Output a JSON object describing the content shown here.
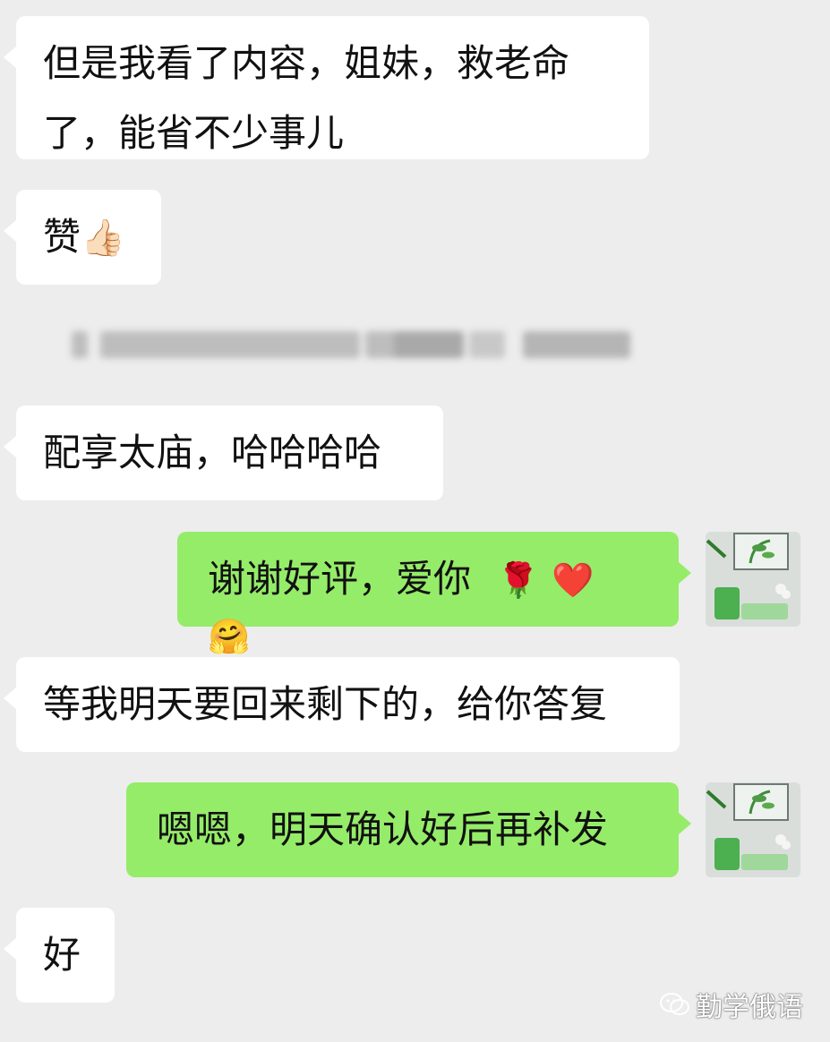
{
  "messages": [
    {
      "side": "left",
      "text_lines": [
        "但是我看了内容，姐妹，救老命",
        "了，能省不少事儿"
      ]
    },
    {
      "side": "left",
      "text": "赞",
      "emoji": "👍🏻"
    },
    {
      "side": "system",
      "text": "（模糊的系统提示）"
    },
    {
      "side": "left",
      "text": "配享太庙，哈哈哈哈"
    },
    {
      "side": "right",
      "text": "谢谢好评，爱你",
      "emojis": [
        "🌹",
        "❤️",
        "🤗"
      ]
    },
    {
      "side": "left",
      "text": "等我明天要回来剩下的，给你答复"
    },
    {
      "side": "right",
      "text": "嗯嗯，明天确认好后再补发"
    },
    {
      "side": "left",
      "text": "好"
    }
  ],
  "watermark": {
    "text": "勤学俄语",
    "icon": "wechat-icon"
  },
  "colors": {
    "background": "#ededed",
    "left_bubble": "#ffffff",
    "right_bubble": "#95ec69"
  }
}
